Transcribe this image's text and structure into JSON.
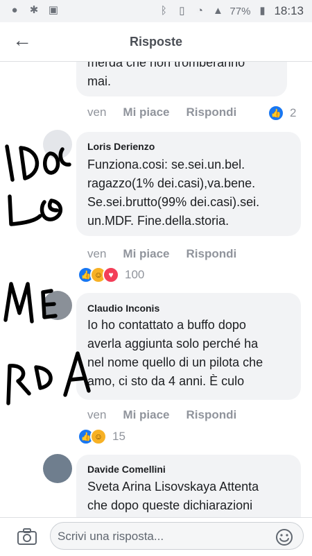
{
  "status_bar": {
    "battery": "77%",
    "time": "18:13",
    "icons": [
      "spotify-icon",
      "bug-icon",
      "image-icon",
      "bluetooth-icon",
      "vibrate-icon",
      "wifi-icon",
      "signal-icon",
      "battery-icon"
    ]
  },
  "header": {
    "title": "Risposte"
  },
  "comments": [
    {
      "text_lines": [
        "merda che non tromberanno",
        "mai."
      ],
      "meta": {
        "time": "ven",
        "like": "Mi piace",
        "reply": "Rispondi"
      },
      "reactions": {
        "types": [
          "like"
        ],
        "count": "2"
      }
    },
    {
      "author": "Loris Derienzo",
      "text_lines": [
        "Funziona.cosi: se.sei.un.bel.",
        "ragazzo(1% dei.casi),va.bene.",
        "Se.sei.brutto(99% dei.casi).sei.",
        "un.MDF. Fine.della.storia."
      ],
      "meta": {
        "time": "ven",
        "like": "Mi piace",
        "reply": "Rispondi"
      },
      "reactions": {
        "types": [
          "like",
          "haha",
          "love"
        ],
        "count": "100"
      }
    },
    {
      "author": "Claudio Inconis",
      "text_lines": [
        "Io ho contattato a buffo dopo",
        "averla aggiunta solo perché ha",
        "nel nome quello di un pilota che",
        "amo, ci sto da 4 anni. È culo"
      ],
      "meta": {
        "time": "ven",
        "like": "Mi piace",
        "reply": "Rispondi"
      },
      "reactions": {
        "types": [
          "like",
          "haha"
        ],
        "count": "15"
      }
    },
    {
      "author": "Davide Comellini",
      "text_lines": [
        "Sveta Arina Lisovskaya Attenta",
        "che dopo queste dichiarazioni"
      ]
    }
  ],
  "composer": {
    "placeholder": "Scrivi una risposta..."
  },
  "colors": {
    "bubble": "#f2f3f5",
    "muted": "#90949c",
    "accent": "#1877f2",
    "ink": "#000000"
  }
}
